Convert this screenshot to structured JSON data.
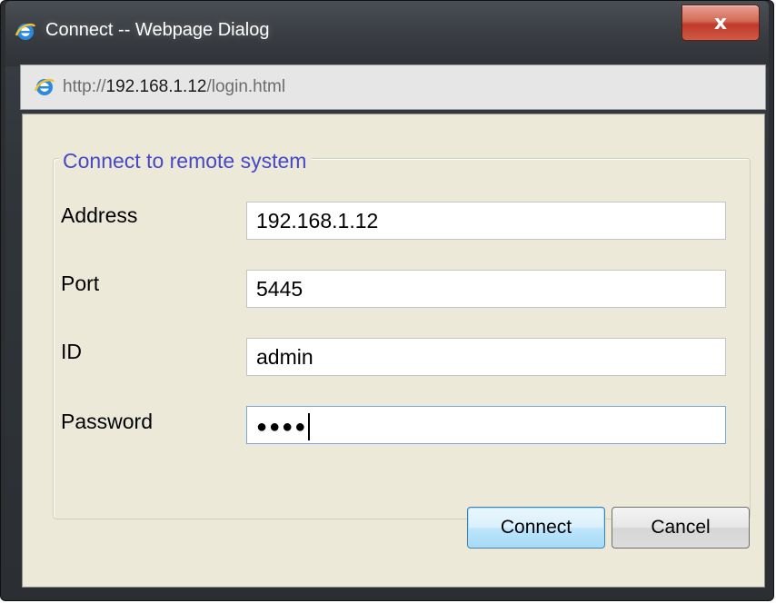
{
  "window": {
    "title": "Connect -- Webpage Dialog",
    "close_label": "x"
  },
  "address_bar": {
    "scheme": "http://",
    "host": "192.168.1.12",
    "path": "/login.html"
  },
  "form": {
    "legend": "Connect to remote system",
    "fields": [
      {
        "label": "Address",
        "value": "192.168.1.12"
      },
      {
        "label": "Port",
        "value": "5445"
      },
      {
        "label": "ID",
        "value": "admin"
      },
      {
        "label": "Password",
        "value": "●●●●"
      }
    ]
  },
  "buttons": {
    "connect": "Connect",
    "cancel": "Cancel"
  },
  "colors": {
    "legend": "#4747c8",
    "content_bg": "#ece9d8",
    "close_button": "#c0392b"
  },
  "icons": {
    "title": "ie-icon",
    "address": "ie-icon"
  }
}
